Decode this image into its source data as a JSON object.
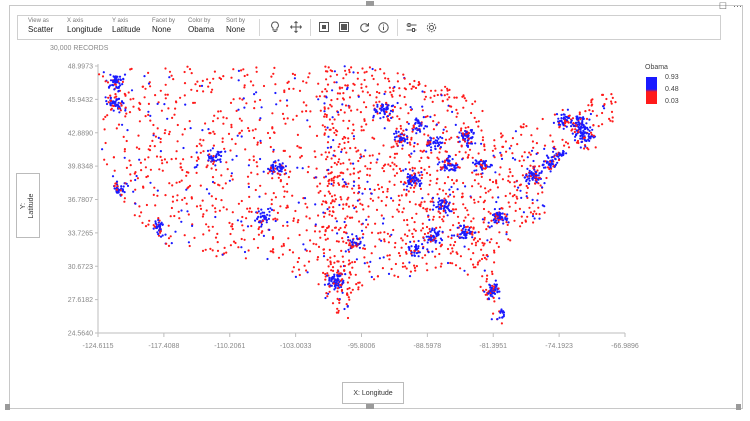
{
  "toolbar": {
    "view_as": {
      "label": "View as",
      "value": "Scatter"
    },
    "x_axis": {
      "label": "X axis",
      "value": "Longitude"
    },
    "y_axis": {
      "label": "Y axis",
      "value": "Latitude"
    },
    "facet_by": {
      "label": "Facet by",
      "value": "None"
    },
    "color_by": {
      "label": "Color by",
      "value": "Obama"
    },
    "sort_by": {
      "label": "Sort by",
      "value": "None"
    }
  },
  "records_label": "30,000 RECORDS",
  "y_axis_button": "Y:\nLatitude",
  "x_axis_button": "X: Longitude",
  "legend": {
    "title": "Obama",
    "ticks": [
      "0.93",
      "0.48",
      "0.03"
    ],
    "colors": [
      "#1a1aff",
      "#ff1a1a"
    ]
  },
  "chart_data": {
    "type": "scatter",
    "x_field": "Longitude",
    "y_field": "Latitude",
    "color_field": "Obama",
    "xlim": [
      -124.6115,
      -66.9896
    ],
    "ylim": [
      24.564,
      48.9973
    ],
    "x_ticks": [
      "-124.6115",
      "-117.4088",
      "-110.2061",
      "-103.0033",
      "-95.8006",
      "-88.5978",
      "-81.3951",
      "-74.1923",
      "-66.9896"
    ],
    "y_ticks": [
      "48.9973",
      "45.9432",
      "42.8890",
      "39.8348",
      "36.7807",
      "33.7265",
      "30.6723",
      "27.6182",
      "24.5640"
    ],
    "record_count": 30000,
    "color_range": [
      0.03,
      0.93
    ]
  }
}
